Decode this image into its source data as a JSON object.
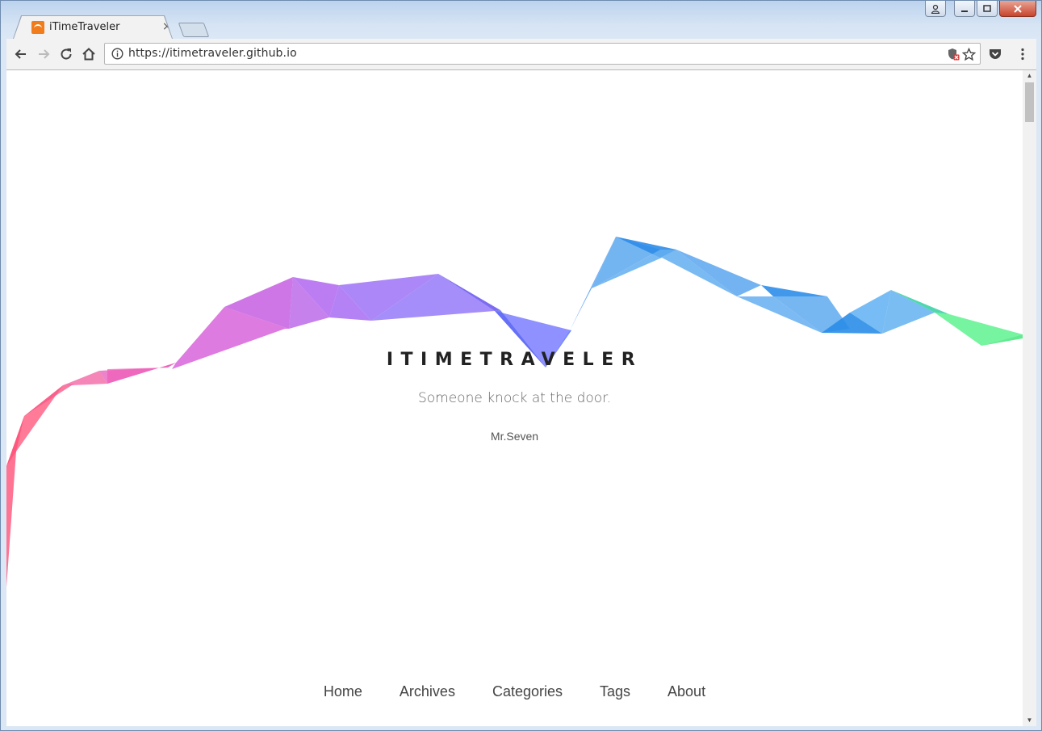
{
  "browser": {
    "tab_title": "iTimeTraveler",
    "tab_close": "×",
    "url": "https://itimetraveler.github.io",
    "icons": [
      "back-icon",
      "forward-icon",
      "reload-icon",
      "home-icon",
      "info-icon",
      "shield-icon",
      "star-icon",
      "pocket-icon",
      "menu-icon"
    ]
  },
  "site": {
    "title": "ITIMETRAVELER",
    "subtitle": "Someone knock at the door.",
    "author": "Mr.Seven"
  },
  "menu": {
    "items": [
      "Home",
      "Archives",
      "Categories",
      "Tags",
      "About"
    ]
  },
  "colors": {
    "ribbon_pink": "#ff5277",
    "ribbon_purple": "#b85cf0",
    "ribbon_violet": "#8a78ff",
    "ribbon_blue": "#3b95ee",
    "ribbon_green": "#5ef28f"
  }
}
